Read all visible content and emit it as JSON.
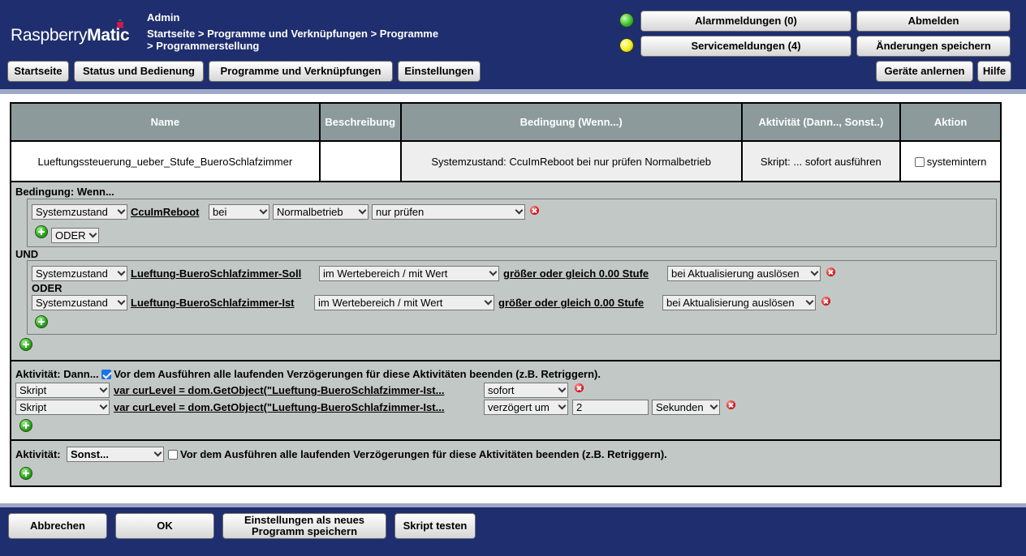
{
  "header": {
    "logo_part1": "Raspberry",
    "logo_part2": "Matic",
    "user": "Admin",
    "breadcrumb_line1": "Startseite > Programme und Verknüpfungen > Programme",
    "breadcrumb_line2": "> Programmerstellung",
    "alarm_button": "Alarmmeldungen (0)",
    "service_button": "Servicemeldungen (4)",
    "logout_button": "Abmelden",
    "save_changes_button": "Änderungen speichern",
    "nav": [
      "Startseite",
      "Status und Bedienung",
      "Programme und Verknüpfungen",
      "Einstellungen"
    ],
    "learn_button": "Geräte anlernen",
    "help_button": "Hilfe",
    "led_colors": {
      "alarm": "#3bbf2a",
      "service": "#f2ee1c"
    }
  },
  "program_table": {
    "headers": [
      "Name",
      "Beschreibung",
      "Bedingung (Wenn...)",
      "Aktivität (Dann.., Sonst..)",
      "Aktion"
    ],
    "row": {
      "name": "Lueftungssteuerung_ueber_Stufe_BueroSchlafzimmer",
      "description": "",
      "condition": "Systemzustand: CcuImReboot bei nur prüfen Normalbetrieb",
      "activity": "Skript: ... sofort ausführen",
      "action_checkbox_label": "systemintern",
      "action_checked": false
    }
  },
  "condition": {
    "title": "Bedingung: Wenn...",
    "block1": {
      "type": "Systemzustand",
      "object": "CcuImReboot",
      "op": "bei",
      "value": "Normalbetrieb",
      "trigger": "nur prüfen",
      "or_select": "ODER"
    },
    "and_label": "UND",
    "block2": {
      "row1": {
        "type": "Systemzustand",
        "object": "Lueftung-BueroSchlafzimmer-Soll",
        "mode": "im Wertebereich / mit Wert",
        "compare": "größer oder gleich 0.00 Stufe",
        "trigger": "bei Aktualisierung auslösen"
      },
      "or_label": "ODER",
      "row2": {
        "type": "Systemzustand",
        "object": "Lueftung-BueroSchlafzimmer-Ist",
        "mode": "im Wertebereich / mit Wert",
        "compare": "größer oder gleich 0.00 Stufe",
        "trigger": "bei Aktualisierung auslösen"
      }
    }
  },
  "then": {
    "title": "Aktivität: Dann...",
    "retrigger_label": "Vor dem Ausführen alle laufenden Verzögerungen für diese Aktivitäten beenden (z.B. Retriggern).",
    "retrigger_checked": true,
    "rows": [
      {
        "type": "Skript",
        "script": "var curLevel = dom.GetObject(\"Lueftung-BueroSchlafzimmer-Ist...",
        "timing": "sofort"
      },
      {
        "type": "Skript",
        "script": "var curLevel = dom.GetObject(\"Lueftung-BueroSchlafzimmer-Ist...",
        "timing": "verzögert um",
        "delay": "2",
        "unit": "Sekunden"
      }
    ]
  },
  "else": {
    "title": "Aktivität:",
    "select": "Sonst...",
    "retrigger_label": "Vor dem Ausführen alle laufenden Verzögerungen für diese Aktivitäten beenden (z.B. Retriggern).",
    "retrigger_checked": false
  },
  "footer": {
    "cancel": "Abbrechen",
    "ok": "OK",
    "save_as_new_line1": "Einstellungen als neues",
    "save_as_new_line2": "Programm speichern",
    "test_script": "Skript testen"
  }
}
